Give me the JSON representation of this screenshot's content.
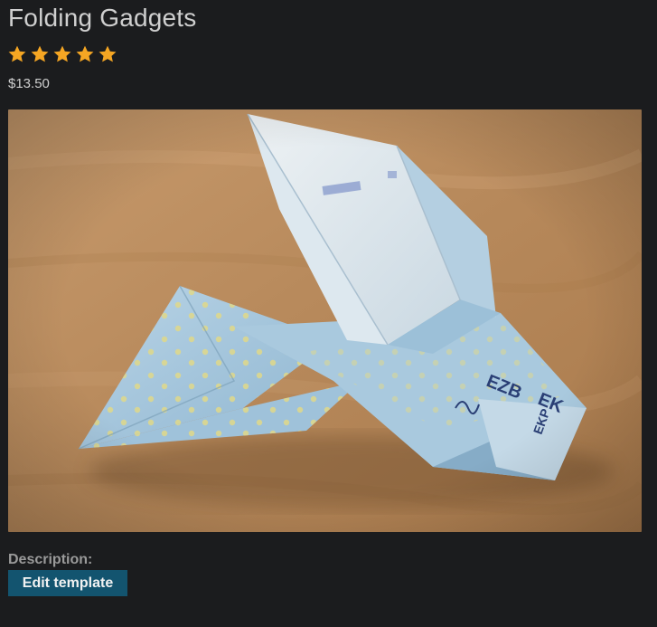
{
  "product": {
    "title": "Folding Gadgets",
    "price": "$13.50",
    "rating": {
      "value": 5,
      "max": 5,
      "color": "#f5a623"
    },
    "image": {
      "subject": "origami-bird-folded-from-banknote"
    }
  },
  "description": {
    "label": "Description:"
  },
  "actions": {
    "edit_template_label": "Edit template",
    "button_color": "#13546f"
  },
  "theme": {
    "background": "#1b1c1e"
  }
}
